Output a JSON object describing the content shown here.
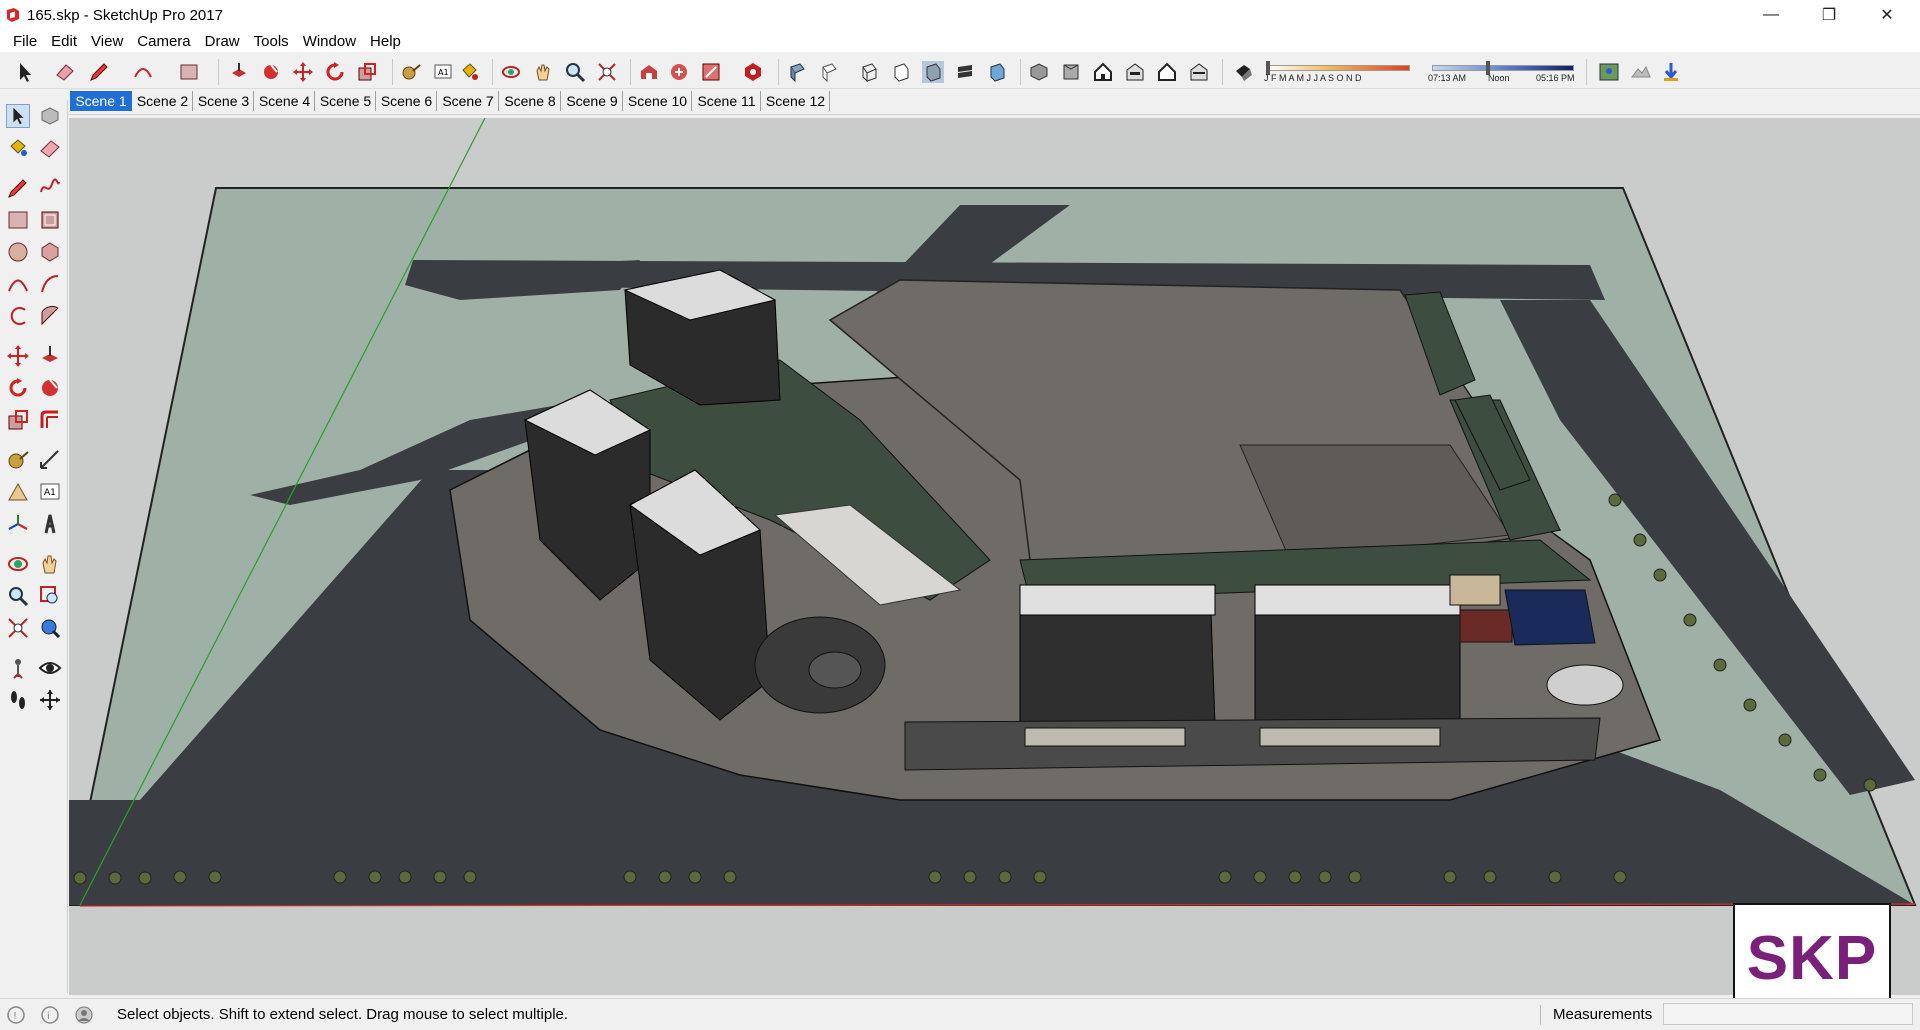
{
  "window": {
    "title": "165.skp - SketchUp Pro 2017",
    "controls": [
      "minimize",
      "restore",
      "close"
    ]
  },
  "menu": [
    "File",
    "Edit",
    "View",
    "Camera",
    "Draw",
    "Tools",
    "Window",
    "Help"
  ],
  "toolbar": {
    "shadow_months": "J F M A M J J A S O N D",
    "time_start": "07:13 AM",
    "time_noon": "Noon",
    "time_end": "05:16 PM"
  },
  "scenes": [
    "Scene 1",
    "Scene 2",
    "Scene 3",
    "Scene 4",
    "Scene 5",
    "Scene 6",
    "Scene 7",
    "Scene 8",
    "Scene 9",
    "Scene 10",
    "Scene 11",
    "Scene 12"
  ],
  "active_scene": "Scene 1",
  "status": {
    "hint": "Select objects. Shift to extend select. Drag mouse to select multiple.",
    "measurements_label": "Measurements",
    "measurements_value": ""
  },
  "logo": {
    "text": "SKP"
  },
  "colors": {
    "accent": "#1f6fd6",
    "road": "#3a3d42",
    "ground": "#9fb0a6",
    "plaza": "#6f6c68",
    "roof": "#3d4d3f",
    "logo": "#7a1f7a"
  }
}
